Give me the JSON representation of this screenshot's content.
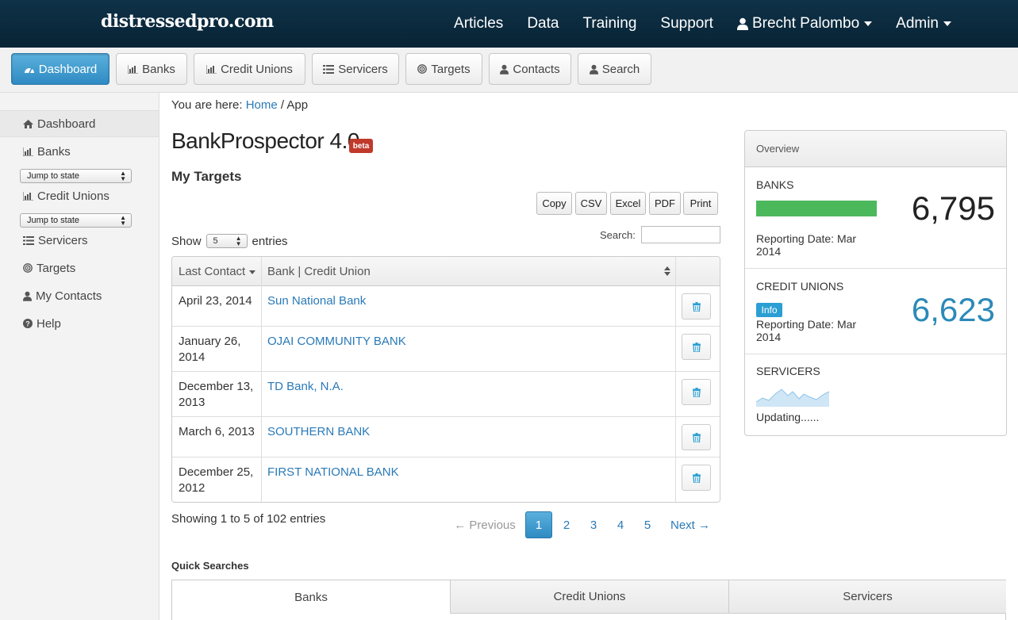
{
  "brand": "distressedpro.com",
  "topnav": {
    "articles": "Articles",
    "data": "Data",
    "training": "Training",
    "support": "Support",
    "user": "Brecht Palombo",
    "admin": "Admin"
  },
  "toolbar": {
    "dashboard": "Dashboard",
    "banks": "Banks",
    "credit_unions": "Credit Unions",
    "servicers": "Servicers",
    "targets": "Targets",
    "contacts": "Contacts",
    "search": "Search"
  },
  "sidebar": {
    "dashboard": "Dashboard",
    "banks": "Banks",
    "jump1": "Jump to state",
    "credit_unions": "Credit Unions",
    "jump2": "Jump to state",
    "servicers": "Servicers",
    "targets": "Targets",
    "my_contacts": "My Contacts",
    "help": "Help"
  },
  "breadcrumb": {
    "prefix": "You are here:",
    "home": "Home",
    "sep": "/",
    "current": "App"
  },
  "title": "BankProspector 4.0",
  "beta": "beta",
  "subtitle": "My Targets",
  "export": {
    "copy": "Copy",
    "csv": "CSV",
    "excel": "Excel",
    "pdf": "PDF",
    "print": "Print"
  },
  "show": {
    "label_pre": "Show",
    "value": "5",
    "label_post": "entries"
  },
  "search_label": "Search:",
  "table": {
    "headers": [
      "Last Contact",
      "Bank | Credit Union"
    ],
    "rows": [
      {
        "date": "April 23, 2014",
        "bank": "Sun National Bank"
      },
      {
        "date": "January 26, 2014",
        "bank": "OJAI COMMUNITY BANK"
      },
      {
        "date": "December 13, 2013",
        "bank": "TD Bank, N.A."
      },
      {
        "date": "March 6, 2013",
        "bank": "SOUTHERN BANK"
      },
      {
        "date": "December 25, 2012",
        "bank": "FIRST NATIONAL BANK"
      }
    ]
  },
  "showing": "Showing 1 to 5 of 102 entries",
  "pagination": {
    "previous": "← Previous",
    "pages": [
      "1",
      "2",
      "3",
      "4",
      "5"
    ],
    "next": "Next →"
  },
  "quick_searches": {
    "title": "Quick Searches",
    "tabs": [
      "Banks",
      "Credit Unions",
      "Servicers"
    ]
  },
  "overview": {
    "title": "Overview",
    "banks_label": "BANKS",
    "banks_count": "6,795",
    "banks_date": "Reporting Date: Mar 2014",
    "cu_label": "CREDIT UNIONS",
    "cu_badge": "Info",
    "cu_count": "6,623",
    "cu_date": "Reporting Date: Mar 2014",
    "servicers_label": "SERVICERS",
    "servicers_status": "Updating......"
  },
  "colors": {
    "topbar": "#0b2a3e",
    "accent": "#2f8bc3",
    "bar_green": "#4cb85c",
    "cu_count": "#2b8ab8",
    "beta_badge": "#c0392b"
  }
}
